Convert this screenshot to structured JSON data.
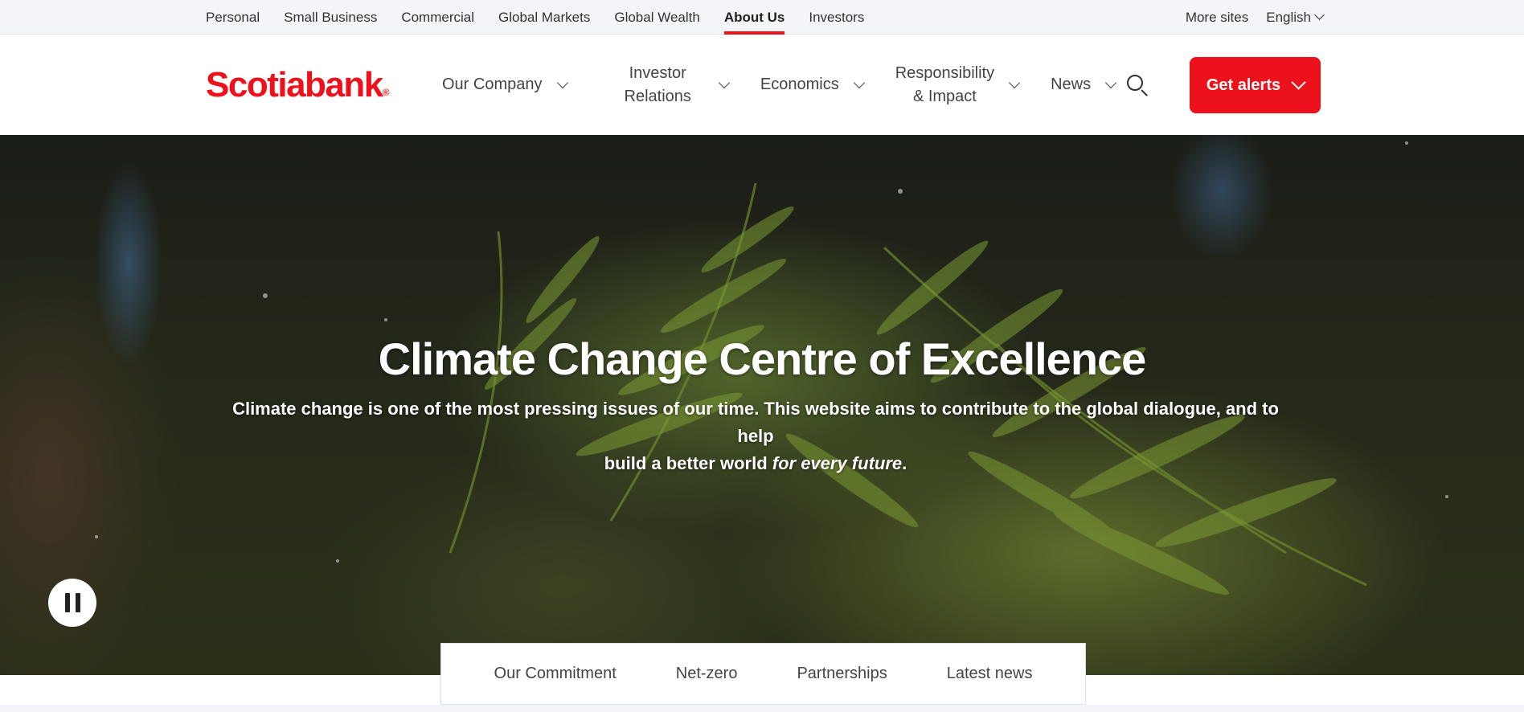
{
  "topbar": {
    "links": [
      "Personal",
      "Small Business",
      "Commercial",
      "Global Markets",
      "Global Wealth",
      "About Us",
      "Investors"
    ],
    "active": "About Us",
    "more_sites": "More sites",
    "language": "English"
  },
  "header": {
    "logo_text": "Scotiabank",
    "logo_mark": "®",
    "nav": [
      {
        "line1": "Our Company",
        "line2": ""
      },
      {
        "line1": "Investor",
        "line2": "Relations"
      },
      {
        "line1": "Economics",
        "line2": ""
      },
      {
        "line1": "Responsibility",
        "line2": "& Impact"
      },
      {
        "line1": "News",
        "line2": ""
      }
    ],
    "alerts_label": "Get alerts"
  },
  "hero": {
    "title": "Climate Change Centre of Excellence",
    "subtitle_line1": "Climate change is one of the most pressing issues of our time. This website aims to contribute to the global dialogue, and to help",
    "subtitle_line2_start": "build a better world ",
    "subtitle_line2_em": "for every future",
    "subtitle_line2_end": "."
  },
  "subtabs": [
    "Our Commitment",
    "Net-zero",
    "Partnerships",
    "Latest news"
  ],
  "colors": {
    "brand_red": "#ec111a",
    "topbar_bg": "#f4f5f8"
  },
  "icons": {
    "search": "search-icon",
    "pause": "pause-icon",
    "chevron": "chevron-down-icon"
  }
}
